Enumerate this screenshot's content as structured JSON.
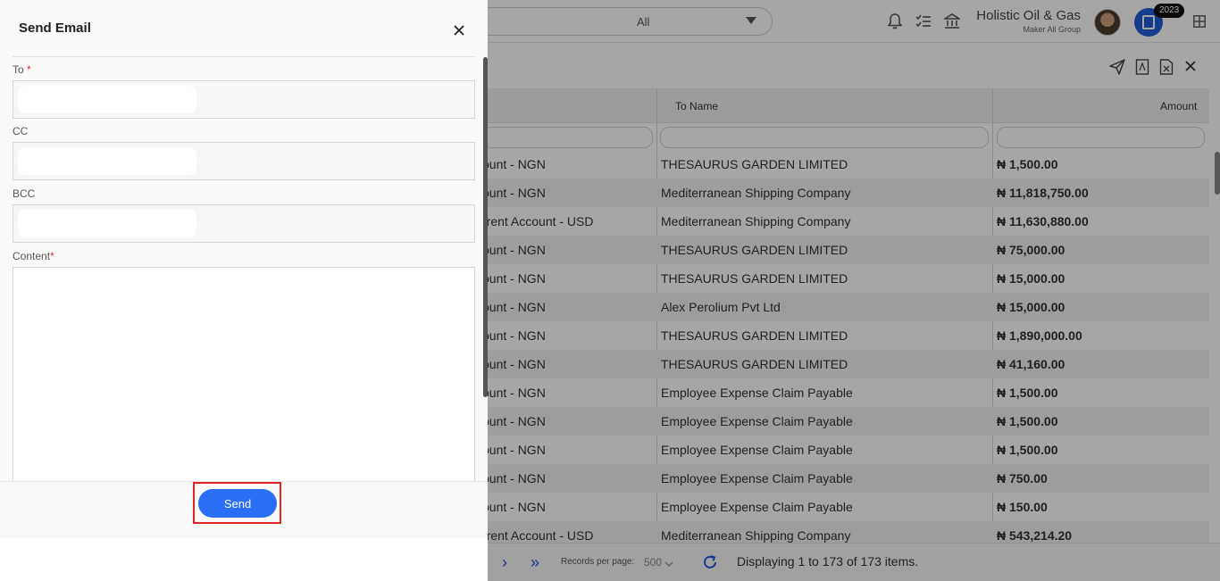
{
  "header": {
    "group_select_value": "All",
    "company_name": "Holistic Oil & Gas",
    "company_subtitle": "Maker All Group",
    "year_badge": "2023",
    "icons": [
      "bell-icon",
      "tasks-icon",
      "bank-icon",
      "avatar",
      "calendar-doc-icon",
      "grid-apps-icon"
    ]
  },
  "toolbar": {
    "icons": [
      "send-icon",
      "pdf-export-icon",
      "excel-export-icon",
      "close-icon"
    ]
  },
  "grid": {
    "columns": [
      "To Name",
      "Amount"
    ],
    "rows": [
      {
        "account": "ount - NGN",
        "to_name": "THESAURUS GARDEN LIMITED",
        "amount": "₦ 1,500.00"
      },
      {
        "account": "ount - NGN",
        "to_name": "Mediterranean Shipping Company",
        "amount": "₦ 11,818,750.00"
      },
      {
        "account": "rrent Account - USD",
        "to_name": "Mediterranean Shipping Company",
        "amount": "₦ 11,630,880.00"
      },
      {
        "account": "ount - NGN",
        "to_name": "THESAURUS GARDEN LIMITED",
        "amount": "₦ 75,000.00"
      },
      {
        "account": "ount - NGN",
        "to_name": "THESAURUS GARDEN LIMITED",
        "amount": "₦ 15,000.00"
      },
      {
        "account": "ount - NGN",
        "to_name": "Alex Perolium Pvt Ltd",
        "amount": "₦ 15,000.00"
      },
      {
        "account": "ount - NGN",
        "to_name": "THESAURUS GARDEN LIMITED",
        "amount": "₦ 1,890,000.00"
      },
      {
        "account": "ount - NGN",
        "to_name": "THESAURUS GARDEN LIMITED",
        "amount": "₦ 41,160.00"
      },
      {
        "account": "ount - NGN",
        "to_name": "Employee Expense Claim Payable",
        "amount": "₦ 1,500.00"
      },
      {
        "account": "ount - NGN",
        "to_name": "Employee Expense Claim Payable",
        "amount": "₦ 1,500.00"
      },
      {
        "account": "ount - NGN",
        "to_name": "Employee Expense Claim Payable",
        "amount": "₦ 1,500.00"
      },
      {
        "account": "ount - NGN",
        "to_name": "Employee Expense Claim Payable",
        "amount": "₦ 750.00"
      },
      {
        "account": "ount - NGN",
        "to_name": "Employee Expense Claim Payable",
        "amount": "₦ 150.00"
      },
      {
        "account": "rrent Account - USD",
        "to_name": "Mediterranean Shipping Company",
        "amount": "₦ 543,214.20"
      }
    ]
  },
  "pager": {
    "next": "›",
    "last": "»",
    "records_per_page_label": "Records per page:",
    "records_per_page_value": "500",
    "display_text": "Displaying 1 to 173 of 173 items."
  },
  "email_dialog": {
    "title": "Send Email",
    "to_label": "To",
    "cc_label": "CC",
    "bcc_label": "BCC",
    "content_label": "Content",
    "required_mark": "*",
    "to_value": "",
    "cc_value": "",
    "bcc_value": "",
    "content_value": "",
    "send_label": "Send"
  }
}
